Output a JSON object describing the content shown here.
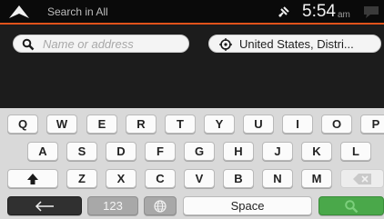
{
  "topbar": {
    "title": "Search in All",
    "time": "5:54",
    "ampm": "am"
  },
  "search": {
    "placeholder": "Name or address",
    "value": "",
    "country_label": "United States, Distri..."
  },
  "keyboard": {
    "row1": [
      "Q",
      "W",
      "E",
      "R",
      "T",
      "Y",
      "U",
      "I",
      "O",
      "P"
    ],
    "row2": [
      "A",
      "S",
      "D",
      "F",
      "G",
      "H",
      "J",
      "K",
      "L"
    ],
    "row3": [
      "Z",
      "X",
      "C",
      "V",
      "B",
      "N",
      "M"
    ],
    "numbers_label": "123",
    "space_label": "Space"
  },
  "colors": {
    "accent": "#e0521b",
    "search_key": "#4aa84a",
    "topbar_bg": "#0a0a0a",
    "keyboard_bg": "#d9d9d9"
  },
  "icons": {
    "navigation": "navigation-arrow-icon",
    "gps": "gps-satellite-icon",
    "messages": "speech-bubble-icon",
    "search": "magnifier-icon",
    "country": "crosshair-target-icon",
    "shift": "shift-arrow-icon",
    "backspace": "backspace-icon",
    "back": "left-arrow-icon",
    "language": "globe-icon",
    "submit": "search-icon"
  }
}
